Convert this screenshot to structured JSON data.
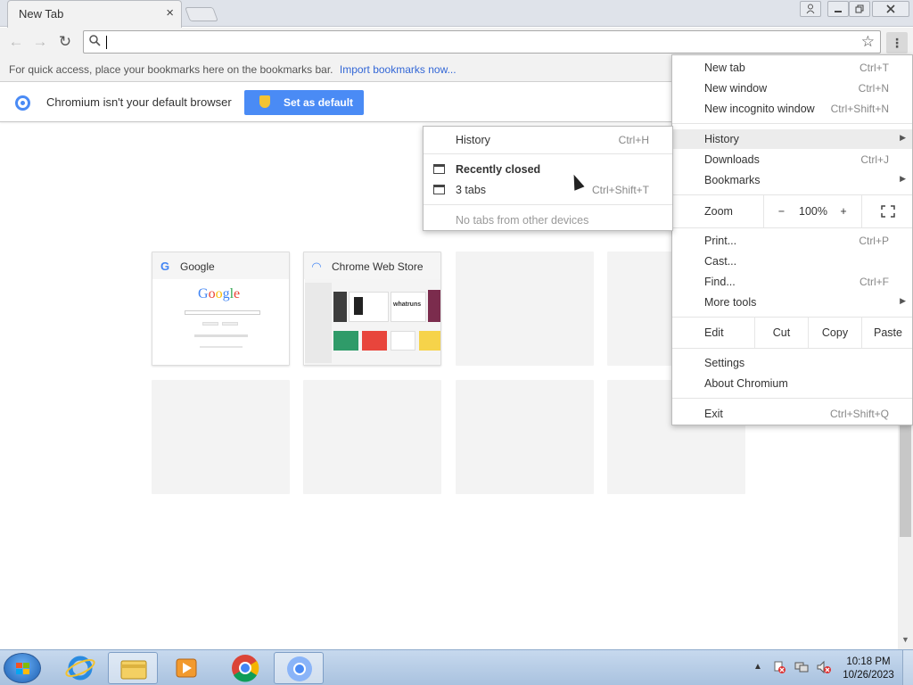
{
  "browser": {
    "tab_title": "New Tab",
    "tab_close": "×",
    "omnibox_value": "",
    "bookmarks_hint": "For quick access, place your bookmarks here on the bookmarks bar.",
    "import_link": "Import bookmarks now...",
    "infobar_text": "Chromium isn't your default browser",
    "set_default_label": "Set as default"
  },
  "tiles": [
    {
      "title": "Google",
      "thumb_text": "Google"
    },
    {
      "title": "Chrome Web Store",
      "thumb_text": "whatruns"
    }
  ],
  "main_menu": {
    "new_tab": {
      "label": "New tab",
      "shortcut": "Ctrl+T"
    },
    "new_window": {
      "label": "New window",
      "shortcut": "Ctrl+N"
    },
    "new_incognito": {
      "label": "New incognito window",
      "shortcut": "Ctrl+Shift+N"
    },
    "history": {
      "label": "History"
    },
    "downloads": {
      "label": "Downloads",
      "shortcut": "Ctrl+J"
    },
    "bookmarks": {
      "label": "Bookmarks"
    },
    "zoom": {
      "label": "Zoom",
      "minus": "−",
      "value": "100%",
      "plus": "+"
    },
    "print": {
      "label": "Print...",
      "shortcut": "Ctrl+P"
    },
    "cast": {
      "label": "Cast..."
    },
    "find": {
      "label": "Find...",
      "shortcut": "Ctrl+F"
    },
    "more_tools": {
      "label": "More tools"
    },
    "edit": {
      "label": "Edit",
      "cut": "Cut",
      "copy": "Copy",
      "paste": "Paste"
    },
    "settings": {
      "label": "Settings"
    },
    "about": {
      "label": "About Chromium"
    },
    "exit": {
      "label": "Exit",
      "shortcut": "Ctrl+Shift+Q"
    }
  },
  "history_menu": {
    "history": {
      "label": "History",
      "shortcut": "Ctrl+H"
    },
    "recently_closed": {
      "label": "Recently closed"
    },
    "tabs": {
      "label": "3 tabs",
      "shortcut": "Ctrl+Shift+T"
    },
    "no_tabs": {
      "label": "No tabs from other devices"
    }
  },
  "taskbar": {
    "time": "10:18 PM",
    "date": "10/26/2023"
  }
}
